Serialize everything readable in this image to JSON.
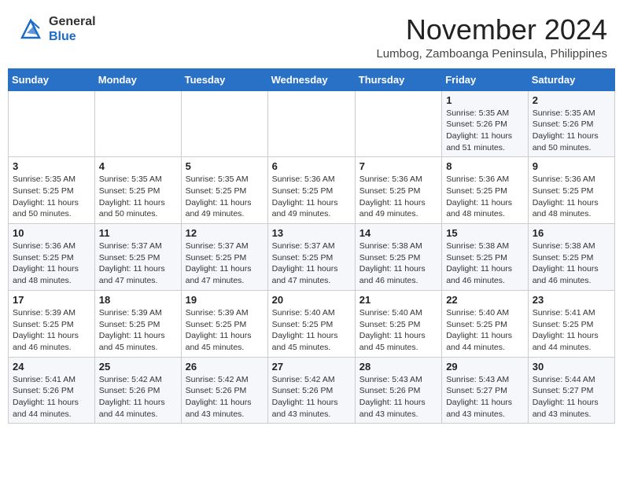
{
  "header": {
    "logo_general": "General",
    "logo_blue": "Blue",
    "month_title": "November 2024",
    "location": "Lumbog, Zamboanga Peninsula, Philippines"
  },
  "weekdays": [
    "Sunday",
    "Monday",
    "Tuesday",
    "Wednesday",
    "Thursday",
    "Friday",
    "Saturday"
  ],
  "weeks": [
    [
      {
        "day": "",
        "info": ""
      },
      {
        "day": "",
        "info": ""
      },
      {
        "day": "",
        "info": ""
      },
      {
        "day": "",
        "info": ""
      },
      {
        "day": "",
        "info": ""
      },
      {
        "day": "1",
        "info": "Sunrise: 5:35 AM\nSunset: 5:26 PM\nDaylight: 11 hours and 51 minutes."
      },
      {
        "day": "2",
        "info": "Sunrise: 5:35 AM\nSunset: 5:26 PM\nDaylight: 11 hours and 50 minutes."
      }
    ],
    [
      {
        "day": "3",
        "info": "Sunrise: 5:35 AM\nSunset: 5:25 PM\nDaylight: 11 hours and 50 minutes."
      },
      {
        "day": "4",
        "info": "Sunrise: 5:35 AM\nSunset: 5:25 PM\nDaylight: 11 hours and 50 minutes."
      },
      {
        "day": "5",
        "info": "Sunrise: 5:35 AM\nSunset: 5:25 PM\nDaylight: 11 hours and 49 minutes."
      },
      {
        "day": "6",
        "info": "Sunrise: 5:36 AM\nSunset: 5:25 PM\nDaylight: 11 hours and 49 minutes."
      },
      {
        "day": "7",
        "info": "Sunrise: 5:36 AM\nSunset: 5:25 PM\nDaylight: 11 hours and 49 minutes."
      },
      {
        "day": "8",
        "info": "Sunrise: 5:36 AM\nSunset: 5:25 PM\nDaylight: 11 hours and 48 minutes."
      },
      {
        "day": "9",
        "info": "Sunrise: 5:36 AM\nSunset: 5:25 PM\nDaylight: 11 hours and 48 minutes."
      }
    ],
    [
      {
        "day": "10",
        "info": "Sunrise: 5:36 AM\nSunset: 5:25 PM\nDaylight: 11 hours and 48 minutes."
      },
      {
        "day": "11",
        "info": "Sunrise: 5:37 AM\nSunset: 5:25 PM\nDaylight: 11 hours and 47 minutes."
      },
      {
        "day": "12",
        "info": "Sunrise: 5:37 AM\nSunset: 5:25 PM\nDaylight: 11 hours and 47 minutes."
      },
      {
        "day": "13",
        "info": "Sunrise: 5:37 AM\nSunset: 5:25 PM\nDaylight: 11 hours and 47 minutes."
      },
      {
        "day": "14",
        "info": "Sunrise: 5:38 AM\nSunset: 5:25 PM\nDaylight: 11 hours and 46 minutes."
      },
      {
        "day": "15",
        "info": "Sunrise: 5:38 AM\nSunset: 5:25 PM\nDaylight: 11 hours and 46 minutes."
      },
      {
        "day": "16",
        "info": "Sunrise: 5:38 AM\nSunset: 5:25 PM\nDaylight: 11 hours and 46 minutes."
      }
    ],
    [
      {
        "day": "17",
        "info": "Sunrise: 5:39 AM\nSunset: 5:25 PM\nDaylight: 11 hours and 46 minutes."
      },
      {
        "day": "18",
        "info": "Sunrise: 5:39 AM\nSunset: 5:25 PM\nDaylight: 11 hours and 45 minutes."
      },
      {
        "day": "19",
        "info": "Sunrise: 5:39 AM\nSunset: 5:25 PM\nDaylight: 11 hours and 45 minutes."
      },
      {
        "day": "20",
        "info": "Sunrise: 5:40 AM\nSunset: 5:25 PM\nDaylight: 11 hours and 45 minutes."
      },
      {
        "day": "21",
        "info": "Sunrise: 5:40 AM\nSunset: 5:25 PM\nDaylight: 11 hours and 45 minutes."
      },
      {
        "day": "22",
        "info": "Sunrise: 5:40 AM\nSunset: 5:25 PM\nDaylight: 11 hours and 44 minutes."
      },
      {
        "day": "23",
        "info": "Sunrise: 5:41 AM\nSunset: 5:25 PM\nDaylight: 11 hours and 44 minutes."
      }
    ],
    [
      {
        "day": "24",
        "info": "Sunrise: 5:41 AM\nSunset: 5:26 PM\nDaylight: 11 hours and 44 minutes."
      },
      {
        "day": "25",
        "info": "Sunrise: 5:42 AM\nSunset: 5:26 PM\nDaylight: 11 hours and 44 minutes."
      },
      {
        "day": "26",
        "info": "Sunrise: 5:42 AM\nSunset: 5:26 PM\nDaylight: 11 hours and 43 minutes."
      },
      {
        "day": "27",
        "info": "Sunrise: 5:42 AM\nSunset: 5:26 PM\nDaylight: 11 hours and 43 minutes."
      },
      {
        "day": "28",
        "info": "Sunrise: 5:43 AM\nSunset: 5:26 PM\nDaylight: 11 hours and 43 minutes."
      },
      {
        "day": "29",
        "info": "Sunrise: 5:43 AM\nSunset: 5:27 PM\nDaylight: 11 hours and 43 minutes."
      },
      {
        "day": "30",
        "info": "Sunrise: 5:44 AM\nSunset: 5:27 PM\nDaylight: 11 hours and 43 minutes."
      }
    ]
  ]
}
